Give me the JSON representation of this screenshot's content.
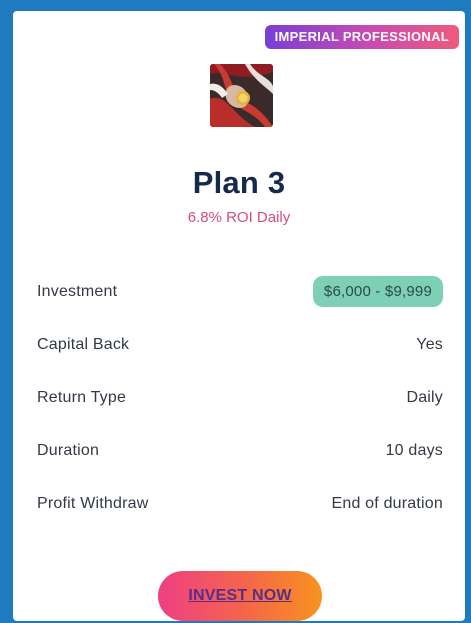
{
  "badge": {
    "text": "IMPERIAL PROFESSIONAL"
  },
  "plan": {
    "image_icon": "plan-thumbnail-image",
    "title": "Plan 3",
    "roi": "6.8% ROI Daily"
  },
  "details": [
    {
      "label": "Investment",
      "value": "$6,000 - $9,999"
    },
    {
      "label": "Capital Back",
      "value": "Yes"
    },
    {
      "label": "Return Type",
      "value": "Daily"
    },
    {
      "label": "Duration",
      "value": "10 days"
    },
    {
      "label": "Profit Withdraw",
      "value": "End of duration"
    }
  ],
  "cta": {
    "label": "INVEST NOW"
  },
  "colors": {
    "frame": "#1f7bbf",
    "title": "#152a4a",
    "roi": "#d64d77",
    "pill": "#7dcfb5"
  }
}
